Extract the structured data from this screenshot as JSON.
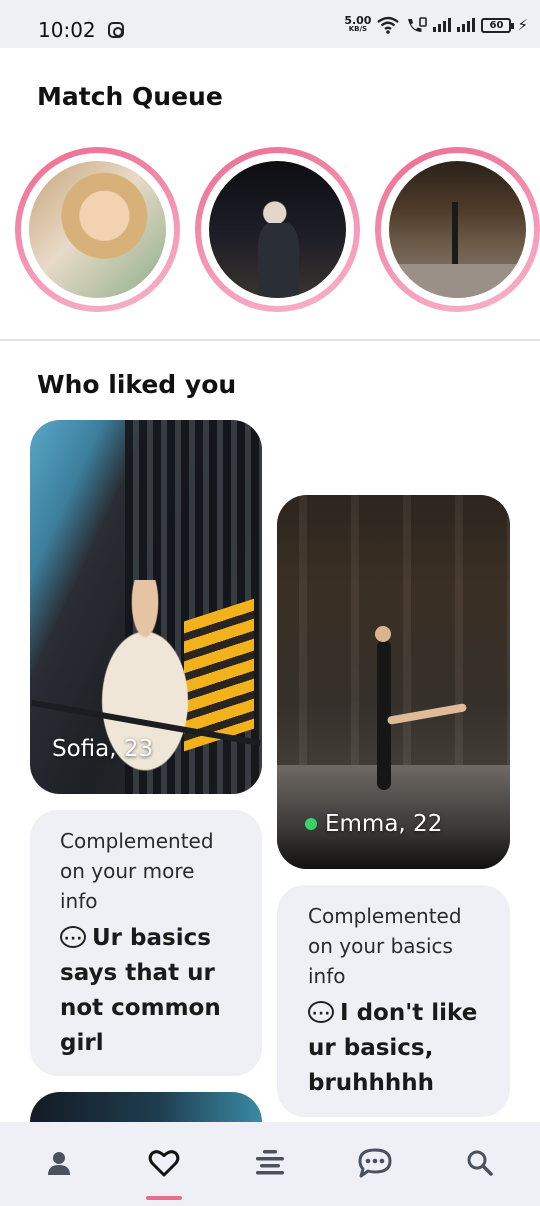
{
  "status_bar": {
    "time": "10:02",
    "net_speed_value": "5.00",
    "net_speed_unit": "KB/S",
    "battery": "60"
  },
  "match_queue": {
    "title": "Match Queue",
    "items": [
      "match-1",
      "match-2",
      "match-3"
    ]
  },
  "who_liked_you": {
    "title": "Who liked you",
    "cards": [
      {
        "name_age": "Sofia, 23",
        "online": false,
        "comment_meta": [
          "Complemented",
          "on your more",
          "info"
        ],
        "comment_message": "Ur basics says that ur not common girl"
      },
      {
        "name_age": "Emma, 22",
        "online": true,
        "comment_meta": [
          "Complemented",
          "on your basics",
          "info"
        ],
        "comment_message": "I don't like ur basics, bruhhhhh"
      }
    ]
  },
  "colors": {
    "accent": "#ec6c8e",
    "online": "#3ad36a",
    "card_bg": "#eef0f5"
  },
  "bottom_nav": {
    "items": [
      "profile-icon",
      "heart-icon",
      "feed-icon",
      "chat-icon",
      "search-icon"
    ],
    "active": "heart-icon"
  }
}
